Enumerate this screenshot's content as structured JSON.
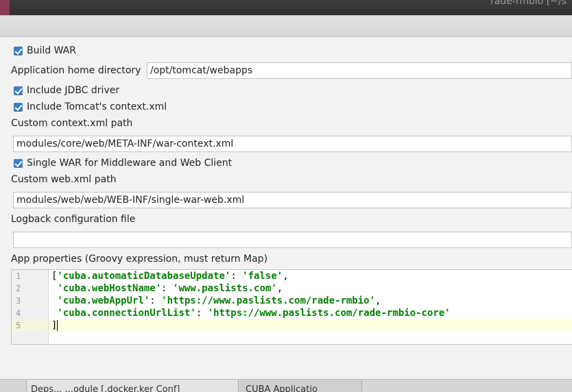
{
  "background": {
    "window_title": "rade-rmbio [~/s",
    "bottom_tabs": [
      "Deps...   ...odule [.docker.ker Conf]",
      "CUBA Applicatio"
    ]
  },
  "build_war": {
    "label": "Build WAR",
    "checked": true
  },
  "app_home": {
    "label": "Application home directory",
    "value": "/opt/tomcat/webapps"
  },
  "include_jdbc": {
    "label": "Include JDBC driver",
    "checked": true
  },
  "include_context": {
    "label": "Include Tomcat's context.xml",
    "checked": true
  },
  "custom_context": {
    "label": "Custom context.xml path",
    "value": "modules/core/web/META-INF/war-context.xml"
  },
  "single_war": {
    "label": "Single WAR for Middleware and Web Client",
    "checked": true
  },
  "custom_web": {
    "label": "Custom web.xml path",
    "value": "modules/web/web/WEB-INF/single-war-web.xml"
  },
  "logback": {
    "label": "Logback configuration file",
    "value": ""
  },
  "app_props": {
    "label": "App properties (Groovy expression, must return Map)",
    "line_numbers": [
      "1",
      "2",
      "3",
      "4",
      "5"
    ],
    "lines": [
      {
        "pre": "[",
        "key": "'cuba.automaticDatabaseUpdate'",
        "sep": ": ",
        "val": "'false'",
        "post": ","
      },
      {
        "pre": " ",
        "key": "'cuba.webHostName'",
        "sep": ": ",
        "val": "'www.paslists.com'",
        "post": ","
      },
      {
        "pre": " ",
        "key": "'cuba.webAppUrl'",
        "sep": ": ",
        "val": "'https://www.paslists.com/rade-rmbio'",
        "post": ","
      },
      {
        "pre": " ",
        "key": "'cuba.connectionUrlList'",
        "sep": ": ",
        "val": "'https://www.paslists.com/rade-rmbio-core'",
        "post": ""
      },
      {
        "pre": "]",
        "key": "",
        "sep": "",
        "val": "",
        "post": ""
      }
    ]
  }
}
